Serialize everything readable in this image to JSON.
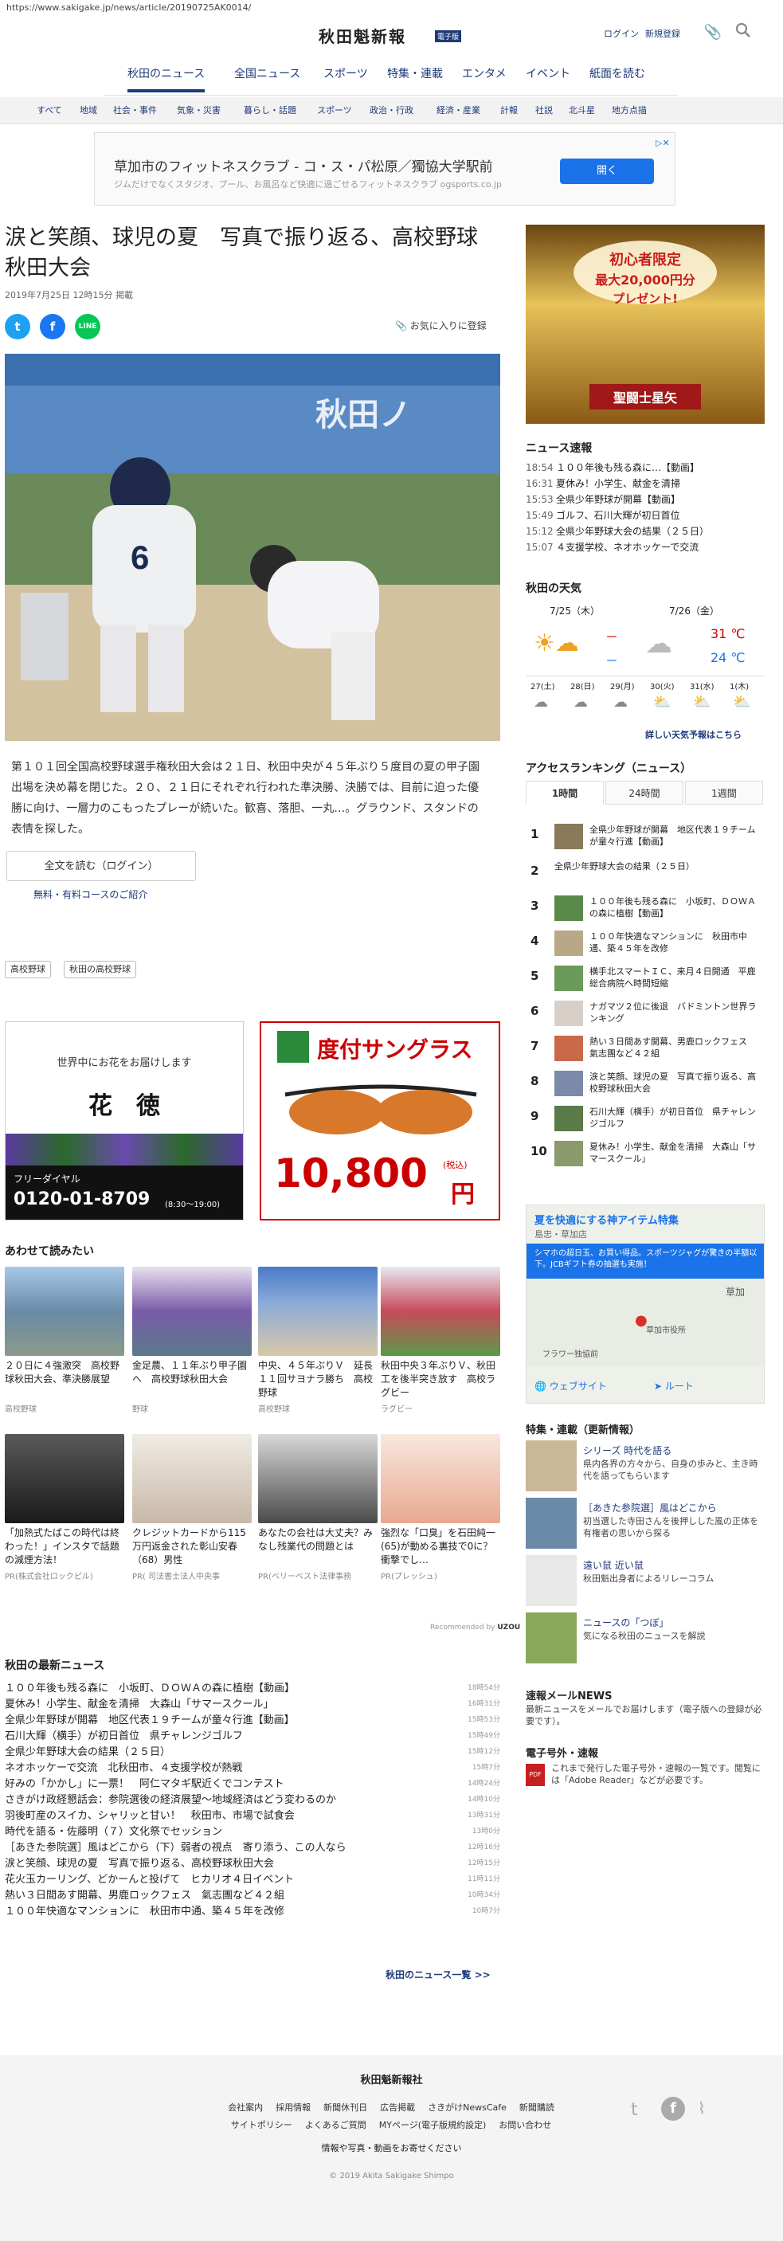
{
  "browser": {
    "url": "https://www.sakigake.jp/news/article/20190725AK0014/"
  },
  "header": {
    "logo": "秋田魁新報",
    "logo_tag": "電子版",
    "login": "ログイン",
    "register": "新規登録",
    "clip_icon": "paperclip-icon",
    "search_icon": "search-icon"
  },
  "nav": {
    "items": [
      "秋田のニュース",
      "全国ニュース",
      "スポーツ",
      "特集・連載",
      "エンタメ",
      "イベント",
      "紙面を読む"
    ]
  },
  "subnav": {
    "items": [
      "すべて",
      "地域",
      "社会・事件",
      "気象・災害",
      "暮らし・話題",
      "スポーツ",
      "政治・行政",
      "経済・産業",
      "計報",
      "社説",
      "北斗星",
      "地方点描"
    ]
  },
  "top_ad": {
    "title": "草加市のフィットネスクラブ - コ・ス・パ松原／獨協大学駅前",
    "sub": "ジムだけでなくスタジオ、プール、お風呂など快適に過ごせるフィットネスクラブ ogsports.co.jp",
    "button": "開く"
  },
  "article": {
    "title": "涙と笑顔、球児の夏　写真で振り返る、高校野球秋田大会",
    "date": "2019年7月25日 12時15分 掲載",
    "favorite": "お気に入りに登録",
    "lead": "第１０１回全国高校野球選手権秋田大会は２１日、秋田中央が４５年ぶり５度目の夏の甲子園出場を決め幕を閉じた。２０、２１日にそれぞれ行われた準決勝、決勝では、目前に迫った優勝に向け、一層力のこもったプレーが続いた。歓喜、落胆、一丸…。グラウンド、スタンドの表情を探した。",
    "read_full": "全文を読む（ログイン）",
    "plans": "無料・有料コースのご紹介",
    "tags": [
      "高校野球",
      "秋田の高校野球"
    ],
    "photo_text": {
      "jersey": "6",
      "banner": "秋田ノ"
    }
  },
  "ads": {
    "flower": {
      "line1": "世界中にお花をお届けします",
      "name": "花　徳",
      "free": "フリーダイヤル",
      "tel": "0120-01-8709",
      "hours": "(8:30〜19:00)"
    },
    "glass": {
      "label": "度付サングラス",
      "price": "10,800",
      "tax": "(税込)",
      "unit": "円"
    }
  },
  "related": {
    "heading": "あわせて読みたい",
    "items": [
      {
        "title": "２０日に４強激突　高校野球秋田大会、準決勝展望",
        "cat": "高校野球"
      },
      {
        "title": "金足農、１１年ぶり甲子園へ　高校野球秋田大会",
        "cat": "野球"
      },
      {
        "title": "中央、４５年ぶりＶ　延長１１回サヨナラ勝ち　高校野球",
        "cat": "高校野球"
      },
      {
        "title": "秋田中央３年ぶりＶ、秋田工を後半突き放す　高校ラグビー",
        "cat": "ラグビー"
      },
      {
        "title": "「加熱式たばこの時代は終わった！」インスタで話題の減煙方法！",
        "cat": "PR(株式会社ロックピル)"
      },
      {
        "title": "クレジットカードから115万円返金された彰山安春（68）男性",
        "cat": "PR( 司法書士法人中央事"
      },
      {
        "title": "あなたの会社は大丈夫？みなし残業代の問題とは",
        "cat": "PR(ベリーベスト法律事務"
      },
      {
        "title": "強烈な「口臭」を石田純一(65)が動める裏技で0に？衝撃でし…",
        "cat": "PR(プレッシュ)"
      }
    ],
    "recommended": "Recommended by",
    "recommended_brand": "UZOU"
  },
  "latest": {
    "heading": "秋田の最新ニュース",
    "items": [
      {
        "t": "１００年後も残る森に　小坂町、ＤＯＷＡの森に植樹【動画】",
        "time": "18時54分"
      },
      {
        "t": "夏休み！小学生、献金を清掃　大森山「サマースクール」",
        "time": "16時31分"
      },
      {
        "t": "全県少年野球が開幕　地区代表１９チームが童々行進【動画】",
        "time": "15時53分"
      },
      {
        "t": "石川大輝（横手）が初日首位　県チャレンジゴルフ",
        "time": "15時49分"
      },
      {
        "t": "全県少年野球大会の結果（２５日）",
        "time": "15時12分"
      },
      {
        "t": "ネオホッケーで交流　北秋田市、４支援学校が熱戦",
        "time": "15時7分"
      },
      {
        "t": "好みの「かかし」に一票！　阿仁マタギ駅近くでコンテスト",
        "time": "14時24分"
      },
      {
        "t": "さきがけ政経懇話会：参院選後の経済展望〜地域経済はどう変わるのか",
        "time": "14時10分"
      },
      {
        "t": "羽後町産のスイカ、シャリッと甘い！　秋田市、市場で試食会",
        "time": "13時31分"
      },
      {
        "t": "時代を語る・佐藤明（７）文化祭でセッション",
        "time": "13時0分"
      },
      {
        "t": "［あきた参院選］風はどこから（下）弱者の視点　寄り添う、この人なら",
        "time": "12時16分"
      },
      {
        "t": "涙と笑顔、球児の夏　写真で振り返る、高校野球秋田大会",
        "time": "12時15分"
      },
      {
        "t": "花火玉カーリング、どかーんと投げて　ヒカリオ４日イベント",
        "time": "11時11分"
      },
      {
        "t": "熱い３日間あす開幕、男鹿ロックフェス　氣志團など４２組",
        "time": "10時34分"
      },
      {
        "t": "１００年快適なマンションに　秋田市中通、築４５年を改修",
        "time": "10時7分"
      }
    ],
    "more": "秋田のニュース一覧 >>"
  },
  "sidebar": {
    "ad": {
      "line1": "初心者限定",
      "line2": "最大20,000円分",
      "line3": "プレゼント!",
      "logo": "聖闘士星矢"
    },
    "brief": {
      "heading": "ニュース速報",
      "items": [
        {
          "time": "18:54",
          "t": "１００年後も残る森に…【動画】"
        },
        {
          "time": "16:31",
          "t": "夏休み！小学生、献金を清掃"
        },
        {
          "time": "15:53",
          "t": "全県少年野球が開幕【動画】"
        },
        {
          "time": "15:49",
          "t": "ゴルフ、石川大輝が初日首位"
        },
        {
          "time": "15:12",
          "t": "全県少年野球大会の結果（２５日）"
        },
        {
          "time": "15:07",
          "t": "４支援学校、ネオホッケーで交流"
        }
      ]
    },
    "weather": {
      "heading": "秋田の天気",
      "d1": "7/25（木）",
      "d2": "7/26（金）",
      "hi1": "－",
      "lo1": "－",
      "hi2": "31 ℃",
      "lo2": "24 ℃",
      "week": [
        "27(土)",
        "28(日)",
        "29(月)",
        "30(火)",
        "31(水)",
        "1(木)"
      ],
      "more": "詳しい天気予報はこちら"
    },
    "ranking": {
      "heading": "アクセスランキング（ニュース）",
      "tabs": [
        "1時間",
        "24時間",
        "1週間"
      ],
      "items": [
        "全県少年野球が開幕　地区代表１９チームが童々行進【動画】",
        "全県少年野球大会の結果（２５日）",
        "１００年後も残る森に　小坂町、ＤＯＷＡの森に植樹【動画】",
        "１００年快適なマンションに　秋田市中通、築４５年を改修",
        "横手北スマートＩＣ、来月４日開通　平鹿総合病院へ時間短縮",
        "ナガマツ２位に後退　バドミントン世界ランキング",
        "熱い３日間あす開幕、男鹿ロックフェス　氣志團など４２組",
        "涙と笑顔、球児の夏　写真で振り返る、高校野球秋田大会",
        "石川大輝（横手）が初日首位　県チャレンジゴルフ",
        "夏休み！小学生、献金を清掃　大森山「サマースクール」"
      ]
    },
    "map_ad": {
      "title": "夏を快適にする神アイテム特集",
      "sub": "島忠・草加店",
      "banner": "シマホの超日玉、お買い得品。スポーツジャグが驚きの半額以下。JCBギフト券の抽選も実施！",
      "place1": "草加",
      "place2": "草加市役所",
      "place3": "フラワー独協前",
      "btn1": "ウェブサイト",
      "btn2": "ルート"
    },
    "features": {
      "heading": "特集・連載（更新情報）",
      "items": [
        {
          "t": "シリーズ 時代を語る",
          "d": "県内各界の方々から、自身の歩みと、主き時代を語ってもらいます"
        },
        {
          "t": "［あきた参院選］風はどこから",
          "d": "初当選した寺田さんを後押しした風の正体を有権者の思いから探る"
        },
        {
          "t": "遠い鼠 近い鼠",
          "d": "秋田魁出身者によるリレーコラム"
        },
        {
          "t": "ニュースの「つぼ」",
          "d": "気になる秋田のニュースを解説"
        }
      ]
    },
    "mail": {
      "heading": "速報メールNEWS",
      "d": "最新ニュースをメールでお届けします（電子版への登録が必要です）。"
    },
    "extra": {
      "heading": "電子号外・速報",
      "d": "これまで発行した電子号外・速報の一覧です。閲覧には「Adobe Reader」などが必要です。"
    }
  },
  "footer": {
    "org": "秋田魁新報社",
    "row1": [
      "会社案内",
      "採用情報",
      "新聞休刊日",
      "広告掲載",
      "さきがけNewsCafe",
      "新聞購読"
    ],
    "row2": [
      "サイトポリシー",
      "よくあるご質問",
      "MYページ(電子版規約設定)",
      "お問い合わせ"
    ],
    "row3": "情報や写真・動画をお寄せください",
    "copyright": "© 2019 Akita Sakigake Shimpo"
  },
  "colors": {
    "navy": "#1d3a7a",
    "red": "#cc0000",
    "twitter": "#1da1f2",
    "facebook": "#1877f2",
    "line": "#06c755"
  }
}
